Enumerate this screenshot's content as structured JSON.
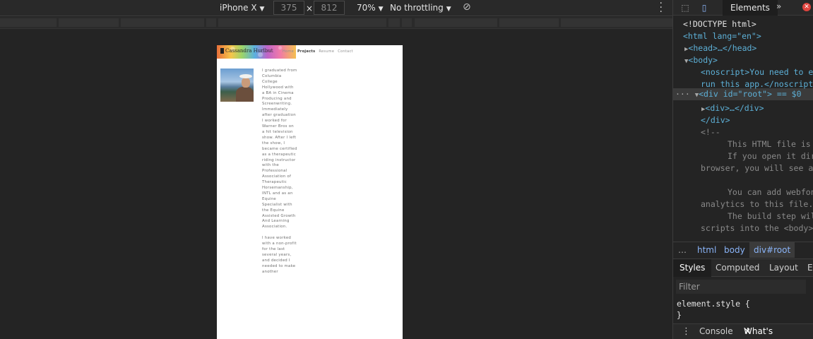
{
  "device_toolbar": {
    "device": "iPhone X",
    "width": "375",
    "times": "×",
    "height": "812",
    "zoom": "70%",
    "throttling": "No throttling"
  },
  "emulated_page": {
    "logo_text": "Cassandra Hurlbut",
    "nav": [
      "Home",
      "Projects",
      "Resume",
      "Contact"
    ],
    "active_nav": "Projects",
    "bio": "I graduated from Columbia College Hollywood with a BA in Cinema Producing and Screenwriting. Immediately after graduation I worked for Warner Bros on a hit television show. After I left the show, I became certified as a therapeutic riding instructor with the Professional Association of Therapeutic Horsemanship, INTL and as an Equine Specialist with the Equine Assisted Growth And Learning Association.\n\nI have worked with a non-profit for the last several years, and decided I needed to make another"
  },
  "devtools": {
    "tabs": {
      "elements": "Elements",
      "more": "»",
      "errors": "✕"
    },
    "dom": {
      "doctype": "<!DOCTYPE html>",
      "html_open": "<html lang=\"en\">",
      "head": "<head>…</head>",
      "body_open": "<body>",
      "noscript_1": "<noscript>You need to ena",
      "noscript_2": "run this app.</noscript>",
      "root_div": "<div id=\"root\"> == $0",
      "inner_div": "<div>…</div>",
      "div_close": "</div>",
      "comment_open": "<!--",
      "comment_1": "This HTML file is a",
      "comment_2": "If you open it dire",
      "comment_3": "browser, you will see an",
      "comment_4": "You can add webfont",
      "comment_5": "analytics to this file.",
      "comment_6": "The build step will",
      "comment_7": "scripts into the <body> t"
    },
    "breadcrumbs": [
      "…",
      "html",
      "body",
      "div#root"
    ],
    "style_tabs": [
      "Styles",
      "Computed",
      "Layout",
      "Ev"
    ],
    "filter_placeholder": "Filter",
    "rule_selector": "element.style {",
    "rule_close": "}",
    "drawer_tabs": [
      "Console",
      "What's New"
    ]
  }
}
